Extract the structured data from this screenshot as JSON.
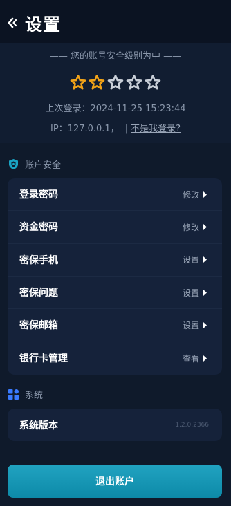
{
  "header": {
    "title": "设置"
  },
  "security": {
    "level_text": "—— 您的账号安全级别为中 ——",
    "stars": {
      "filled": 2,
      "total": 5
    },
    "last_login": "上次登录：2024-11-25 15:23:44",
    "ip": "IP：127.0.0.1，",
    "separator": "|",
    "not_me_link": "不是我登录?"
  },
  "account_section": {
    "title": "账户安全",
    "items": [
      {
        "label": "登录密码",
        "action": "修改"
      },
      {
        "label": "资金密码",
        "action": "修改"
      },
      {
        "label": "密保手机",
        "action": "设置"
      },
      {
        "label": "密保问题",
        "action": "设置"
      },
      {
        "label": "密保邮箱",
        "action": "设置"
      },
      {
        "label": "银行卡管理",
        "action": "查看"
      }
    ]
  },
  "system_section": {
    "title": "系统",
    "items": [
      {
        "label": "系统版本",
        "value": "1.2.0.2366"
      }
    ]
  },
  "logout_label": "退出账户",
  "colors": {
    "background": "#0f1a2b",
    "card": "#15223a",
    "star_filled": "#f2a318",
    "star_empty": "#c9cfd8",
    "accent": "#1a9ab7"
  }
}
